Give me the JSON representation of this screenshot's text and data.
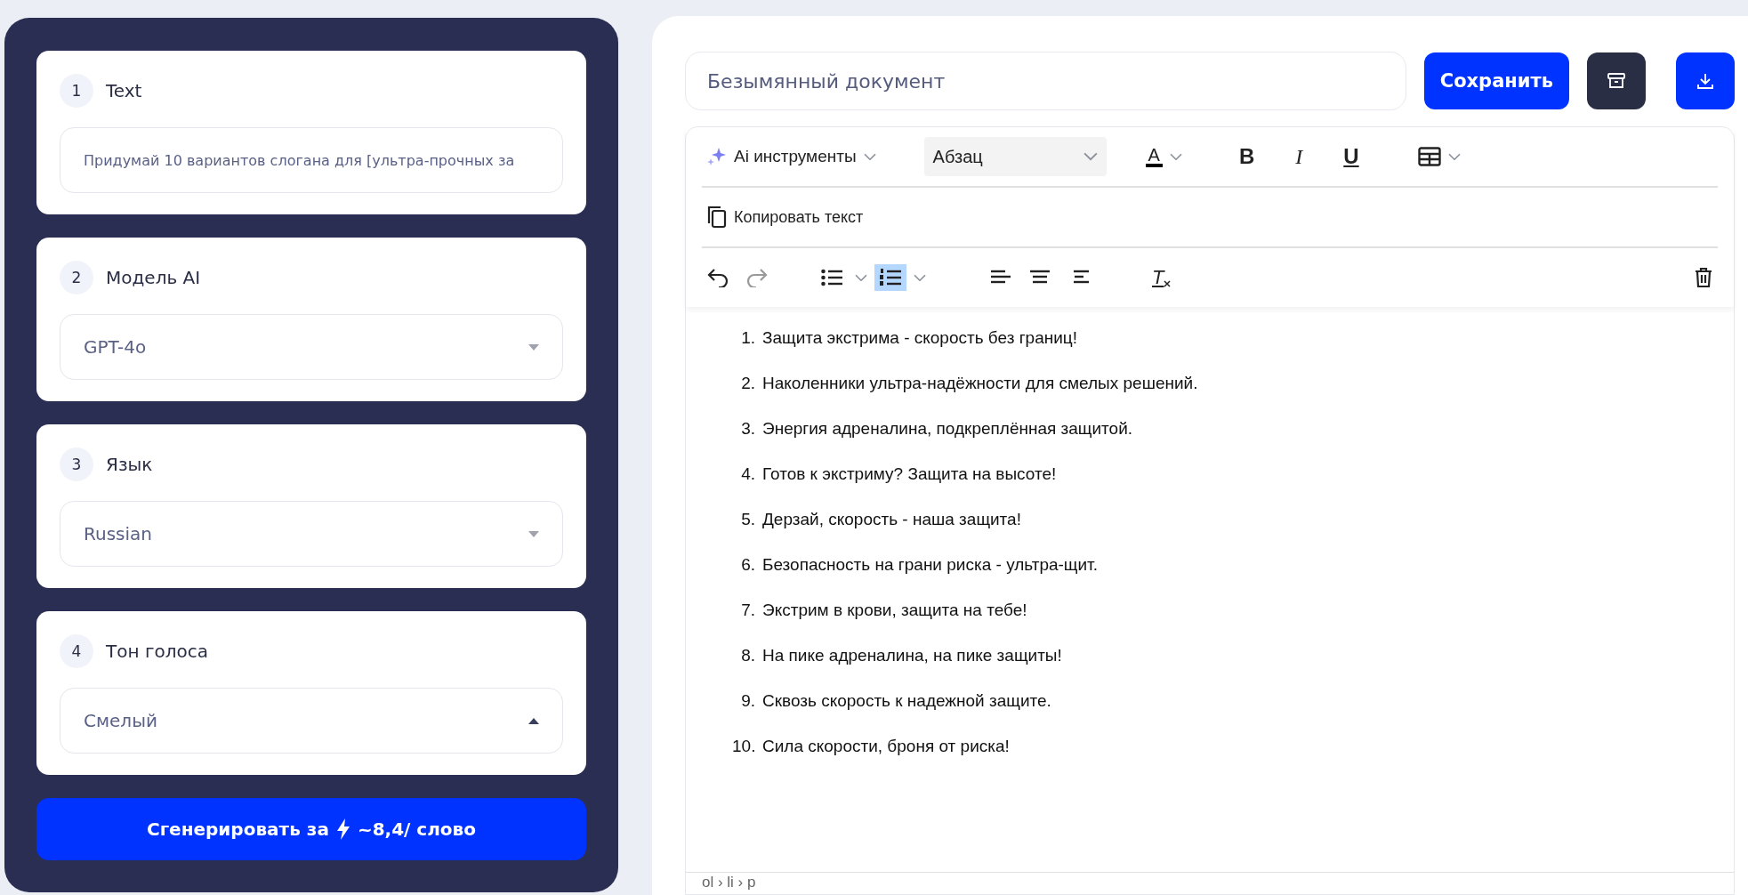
{
  "steps": [
    {
      "number": "1",
      "label": "Text",
      "kind": "text",
      "value": "Придумай 10 вариантов слогана для [ультра-прочных за"
    },
    {
      "number": "2",
      "label": "Модель AI",
      "kind": "select",
      "value": "GPT-4o",
      "expanded": false
    },
    {
      "number": "3",
      "label": "Язык",
      "kind": "select",
      "value": "Russian",
      "expanded": false
    },
    {
      "number": "4",
      "label": "Тон голоса",
      "kind": "select",
      "value": "Смелый",
      "expanded": true
    }
  ],
  "generate_button": {
    "label": "Сгенерировать за",
    "cost": "~8,4/ слово"
  },
  "document": {
    "title": "Безымянный документ",
    "save_label": "Сохранить"
  },
  "toolbar": {
    "ai_tools": "Ai инструменты",
    "block_format": "Абзац",
    "text_color": {
      "glyph": "A",
      "color": "#000000"
    },
    "format_buttons": [
      {
        "kind": "bold",
        "glyph": "B"
      },
      {
        "kind": "italic",
        "glyph": "I"
      },
      {
        "kind": "underline",
        "glyph": "U"
      }
    ],
    "copy_text": "Копировать текст",
    "undo": {
      "disabled": false
    },
    "redo": {
      "disabled": true
    },
    "list_buttons": [
      {
        "kind": "bullet",
        "selected": false
      },
      {
        "kind": "numbered",
        "selected": true
      }
    ],
    "align_buttons": [
      {
        "kind": "left"
      },
      {
        "kind": "center"
      },
      {
        "kind": "right"
      }
    ],
    "clear_format": {
      "glyph": "T"
    }
  },
  "content": {
    "items": [
      {
        "number": "1.",
        "text": "Защита экстрима - скорость без границ!"
      },
      {
        "number": "2.",
        "text": "Наколенники ультра-надёжности для смелых решений."
      },
      {
        "number": "3.",
        "text": "Энергия адреналина, подкреплённая защитой."
      },
      {
        "number": "4.",
        "text": "Готов к экстриму? Защита на высоте!"
      },
      {
        "number": "5.",
        "text": "Дерзай, скорость - наша защита!"
      },
      {
        "number": "6.",
        "text": "Безопасность на грани риска - ультра-щит."
      },
      {
        "number": "7.",
        "text": "Экстрим в крови, защита на тебе!"
      },
      {
        "number": "8.",
        "text": "На пике адреналина, на пике защиты!"
      },
      {
        "number": "9.",
        "text": "Сквозь скорость к надежной защите."
      },
      {
        "number": "10.",
        "text": "Сила скорости, броня от риска!"
      }
    ]
  },
  "status_bar": {
    "path": "ol › li › p"
  }
}
